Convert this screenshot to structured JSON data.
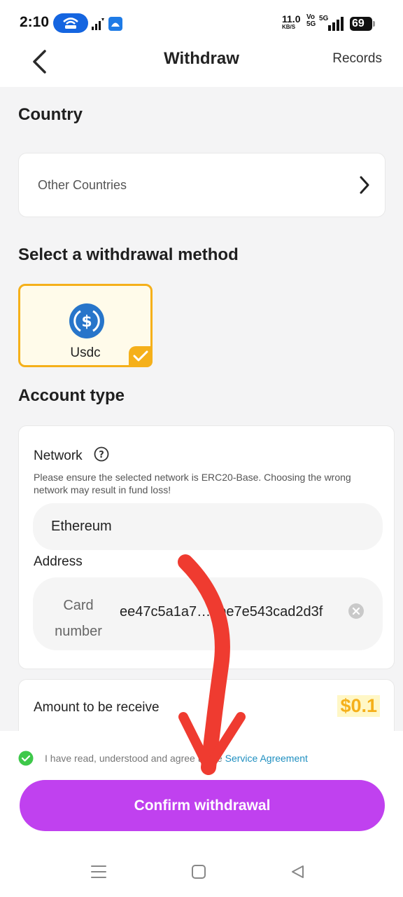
{
  "status_bar": {
    "time": "2:10",
    "speed_value": "11.0",
    "speed_unit": "KB/S",
    "volte_top": "Vo",
    "volte_bottom": "5G",
    "network_type": "5G",
    "battery": "69"
  },
  "header": {
    "title": "Withdraw",
    "records_label": "Records"
  },
  "country": {
    "section_title": "Country",
    "value": "Other Countries"
  },
  "method": {
    "section_title": "Select a withdrawal method",
    "selected_label": "Usdc"
  },
  "account": {
    "section_title": "Account type",
    "network_label": "Network",
    "warning": "Please ensure the selected network is ERC20-Base. Choosing the wrong network may result in fund loss!",
    "network_value": "Ethereum",
    "address_label": "Address",
    "card_number_label": "Card number",
    "address_value": "ee47c5a1a7…9be7e543cad2d3f"
  },
  "amount": {
    "label": "Amount to be receive",
    "value": "$0.1"
  },
  "agreement": {
    "text": "I have read, understood and agree to the",
    "link": "Service Agreement"
  },
  "confirm_label": "Confirm withdrawal",
  "colors": {
    "accent_yellow": "#f5b01a",
    "confirm_purple": "#c041ef",
    "usdc_blue": "#2775ca",
    "link_blue": "#1f8fc0",
    "check_green": "#3ec84a",
    "annotation_red": "#ef3b30"
  }
}
